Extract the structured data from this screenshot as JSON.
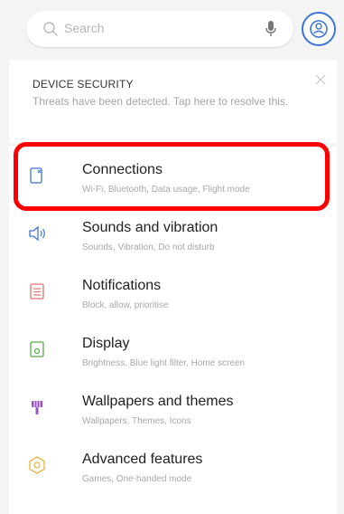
{
  "search": {
    "placeholder": "Search"
  },
  "security": {
    "title": "DEVICE SECURITY",
    "description": "Threats have been detected. Tap here to resolve this."
  },
  "settings": [
    {
      "title": "Connections",
      "subtitle": "Wi-Fi, Bluetooth, Data usage, Flight mode",
      "icon": "connections-icon"
    },
    {
      "title": "Sounds and vibration",
      "subtitle": "Sounds, Vibration, Do not disturb",
      "icon": "speaker-icon"
    },
    {
      "title": "Notifications",
      "subtitle": "Block, allow, prioritise",
      "icon": "notifications-icon"
    },
    {
      "title": "Display",
      "subtitle": "Brightness, Blue light filter, Home screen",
      "icon": "display-icon"
    },
    {
      "title": "Wallpapers and themes",
      "subtitle": "Wallpapers, Themes, Icons",
      "icon": "palette-icon"
    },
    {
      "title": "Advanced features",
      "subtitle": "Games, One-handed mode",
      "icon": "advanced-features-icon"
    }
  ],
  "colors": {
    "accent_blue": "#3d75d6",
    "highlight_red": "#ff0000",
    "notifications_red": "#e2726c",
    "display_green": "#5aaa4b",
    "themes_purple": "#9b4fc9",
    "advanced_yellow": "#e7b53a"
  }
}
